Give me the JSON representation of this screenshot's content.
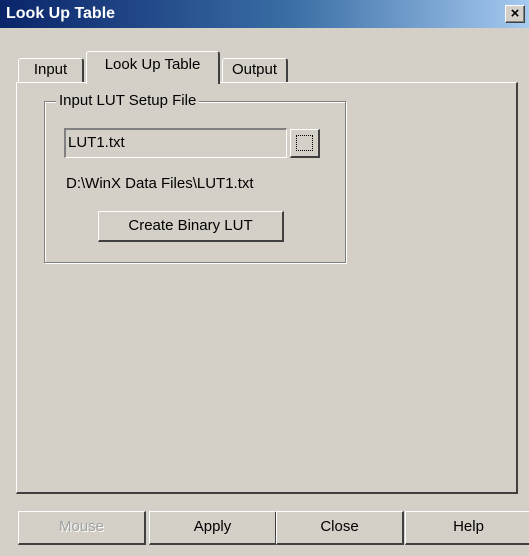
{
  "window": {
    "title": "Look Up Table",
    "close_symbol": "×"
  },
  "tabs": [
    {
      "label": "Input",
      "selected": false
    },
    {
      "label": "Look Up Table",
      "selected": true
    },
    {
      "label": "Output",
      "selected": false
    }
  ],
  "setup_group": {
    "label": "Input LUT Setup File",
    "file_field_value": "LUT1.txt",
    "file_path": "D:\\WinX Data Files\\LUT1.txt",
    "create_button_label": "Create Binary LUT"
  },
  "bottom_buttons": {
    "mouse_label": "Mouse",
    "mouse_enabled": false,
    "apply_label": "Apply",
    "close_label": "Close",
    "help_label": "Help"
  },
  "colors": {
    "face": "#d4d0c8",
    "titlebar_start": "#0a246a",
    "titlebar_end": "#a6caf0",
    "disabled_text": "#a0a0a0"
  }
}
